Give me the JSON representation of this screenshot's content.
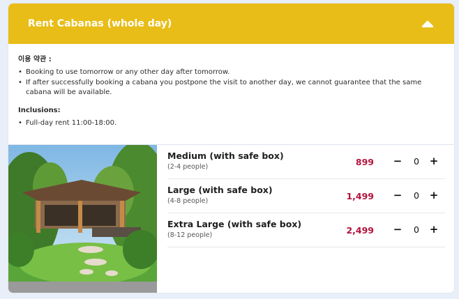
{
  "section": {
    "title": "Rent Cabanas (whole day)",
    "collapse_icon": "chevron-up-icon",
    "accent_color": "#e8bd17",
    "price_color": "#b3133c"
  },
  "terms": {
    "heading": "이용 약관 :",
    "items": [
      "Booking to use tomorrow or any other day after tomorrow.",
      "If after successfully booking a cabana you postpone the visit to another day, we cannot guarantee that the same cabana will be available."
    ]
  },
  "inclusions": {
    "heading": "Inclusions:",
    "items": [
      "Full-day rent 11:00-18:00."
    ]
  },
  "options": [
    {
      "name": "Medium (with safe box)",
      "people": "(2-4 people)",
      "price": "899",
      "qty": "0",
      "minus": "−",
      "plus": "+"
    },
    {
      "name": "Large (with safe box)",
      "people": "(4-8 people)",
      "price": "1,499",
      "qty": "0",
      "minus": "−",
      "plus": "+"
    },
    {
      "name": "Extra Large (with safe box)",
      "people": "(8-12 people)",
      "price": "2,499",
      "qty": "0",
      "minus": "−",
      "plus": "+"
    }
  ]
}
